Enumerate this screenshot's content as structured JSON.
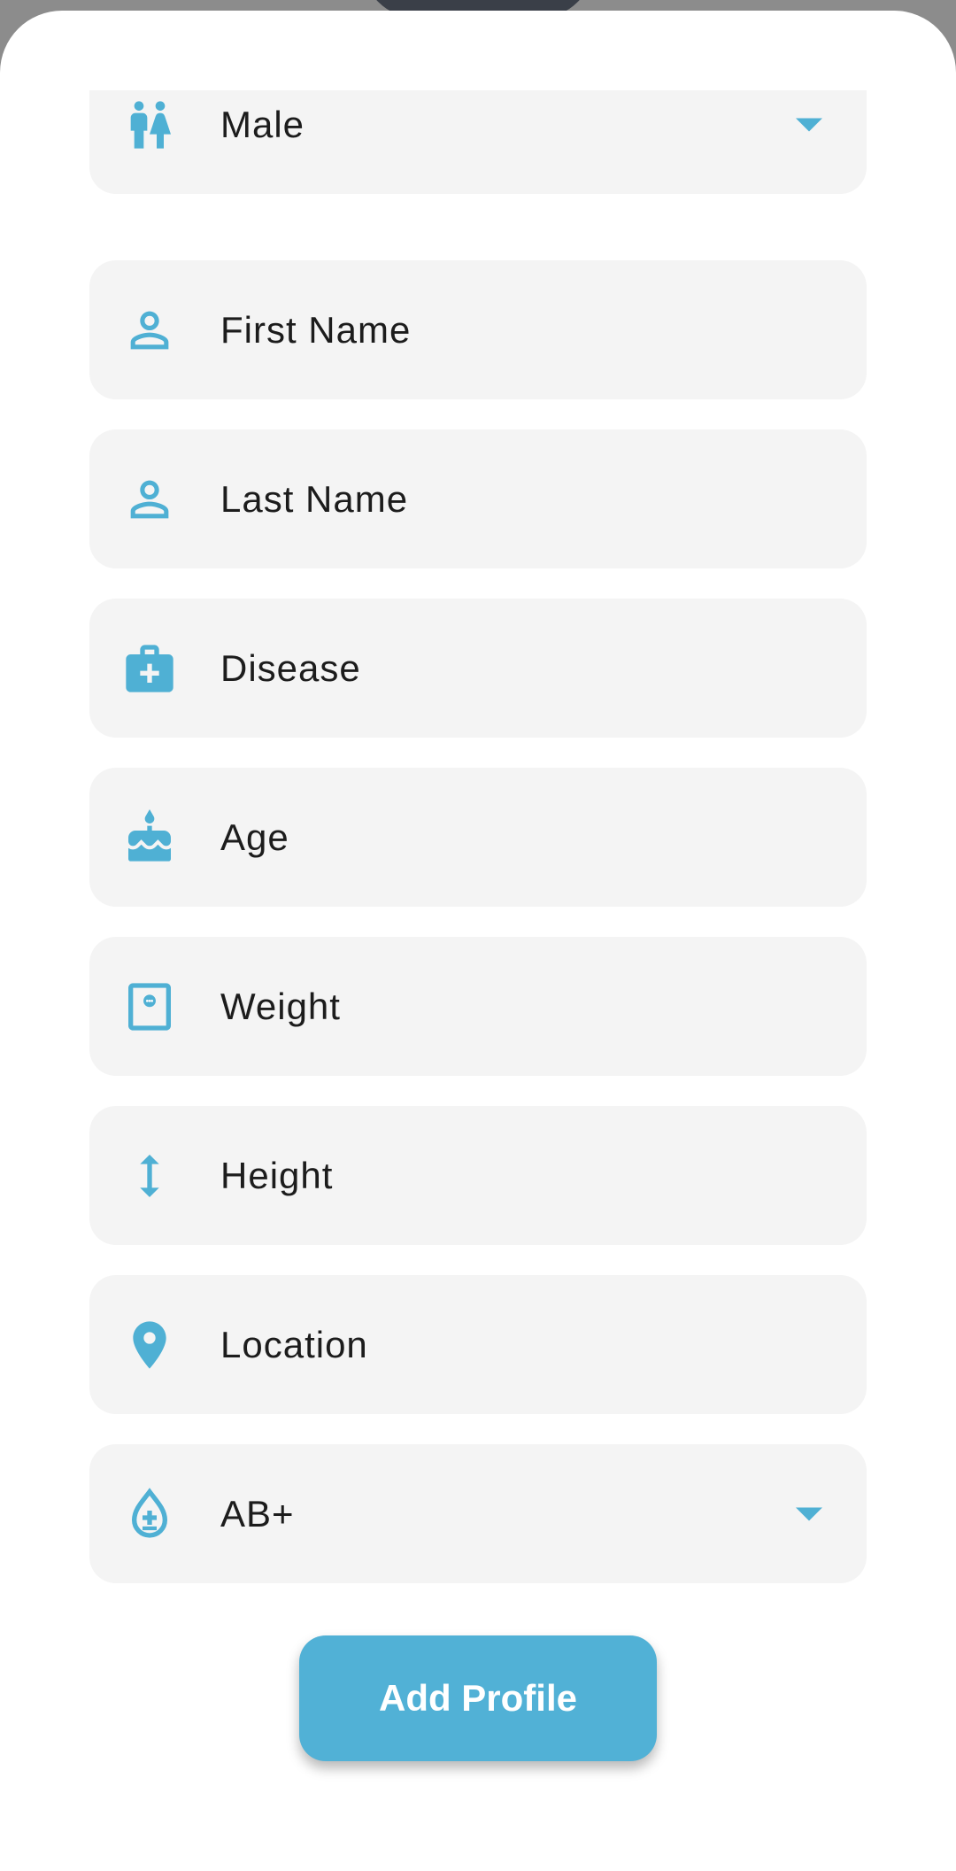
{
  "form": {
    "gender": {
      "value": "Male",
      "icon": "wc-icon"
    },
    "first_name": {
      "placeholder": "First Name",
      "icon": "person-icon"
    },
    "last_name": {
      "placeholder": "Last Name",
      "icon": "person-icon"
    },
    "disease": {
      "placeholder": "Disease",
      "icon": "medical-bag-icon"
    },
    "age": {
      "placeholder": "Age",
      "icon": "cake-icon"
    },
    "weight": {
      "placeholder": "Weight",
      "icon": "scale-icon"
    },
    "height": {
      "placeholder": "Height",
      "icon": "vertical-arrows-icon"
    },
    "location": {
      "placeholder": "Location",
      "icon": "location-pin-icon"
    },
    "blood_type": {
      "value": "AB+",
      "icon": "blood-drop-icon"
    }
  },
  "actions": {
    "add_profile_label": "Add Profile"
  },
  "colors": {
    "accent": "#4fb0d4",
    "field_bg": "#f4f4f4",
    "button": "#51b1d6"
  }
}
